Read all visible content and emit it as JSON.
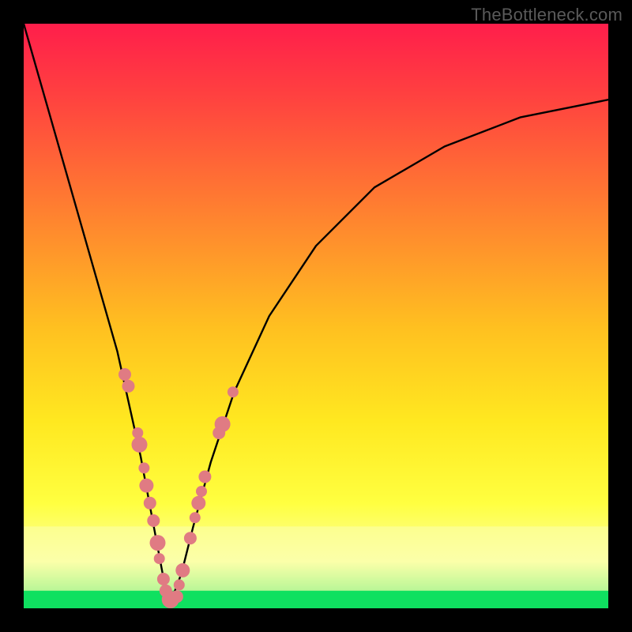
{
  "watermark": "TheBottleneck.com",
  "chart_data": {
    "type": "line",
    "title": "",
    "xlabel": "",
    "ylabel": "",
    "xlim": [
      0,
      1
    ],
    "ylim": [
      0,
      1
    ],
    "grid": false,
    "background_gradient": [
      "#ff1e4b",
      "#ff4040",
      "#ff8030",
      "#ffc020",
      "#ffe820",
      "#ffff40",
      "#fbffa0",
      "#10e060"
    ],
    "green_band_y": [
      0.0,
      0.03
    ],
    "pale_band_y": [
      0.03,
      0.14
    ],
    "series": [
      {
        "name": "bottleneck-curve",
        "color": "#000000",
        "x": [
          0.0,
          0.04,
          0.08,
          0.12,
          0.16,
          0.2,
          0.23,
          0.245,
          0.255,
          0.27,
          0.29,
          0.32,
          0.36,
          0.42,
          0.5,
          0.6,
          0.72,
          0.85,
          1.0
        ],
        "y": [
          1.0,
          0.86,
          0.72,
          0.58,
          0.44,
          0.26,
          0.1,
          0.02,
          0.02,
          0.06,
          0.14,
          0.25,
          0.37,
          0.5,
          0.62,
          0.72,
          0.79,
          0.84,
          0.87
        ]
      }
    ],
    "markers": {
      "name": "highlight-dots",
      "color": "#e07b83",
      "radius_range": [
        5,
        11
      ],
      "points": [
        {
          "x": 0.173,
          "y": 0.4,
          "r": 8
        },
        {
          "x": 0.179,
          "y": 0.38,
          "r": 8
        },
        {
          "x": 0.195,
          "y": 0.3,
          "r": 7
        },
        {
          "x": 0.198,
          "y": 0.28,
          "r": 10
        },
        {
          "x": 0.206,
          "y": 0.24,
          "r": 7
        },
        {
          "x": 0.21,
          "y": 0.21,
          "r": 9
        },
        {
          "x": 0.216,
          "y": 0.18,
          "r": 8
        },
        {
          "x": 0.222,
          "y": 0.15,
          "r": 8
        },
        {
          "x": 0.229,
          "y": 0.112,
          "r": 10
        },
        {
          "x": 0.232,
          "y": 0.085,
          "r": 7
        },
        {
          "x": 0.239,
          "y": 0.05,
          "r": 8
        },
        {
          "x": 0.243,
          "y": 0.03,
          "r": 8
        },
        {
          "x": 0.251,
          "y": 0.015,
          "r": 11
        },
        {
          "x": 0.262,
          "y": 0.02,
          "r": 8
        },
        {
          "x": 0.266,
          "y": 0.04,
          "r": 7
        },
        {
          "x": 0.272,
          "y": 0.065,
          "r": 9
        },
        {
          "x": 0.285,
          "y": 0.12,
          "r": 8
        },
        {
          "x": 0.293,
          "y": 0.155,
          "r": 7
        },
        {
          "x": 0.299,
          "y": 0.18,
          "r": 9
        },
        {
          "x": 0.304,
          "y": 0.2,
          "r": 7
        },
        {
          "x": 0.31,
          "y": 0.225,
          "r": 8
        },
        {
          "x": 0.334,
          "y": 0.3,
          "r": 8
        },
        {
          "x": 0.34,
          "y": 0.315,
          "r": 10
        },
        {
          "x": 0.358,
          "y": 0.37,
          "r": 7
        }
      ]
    }
  }
}
